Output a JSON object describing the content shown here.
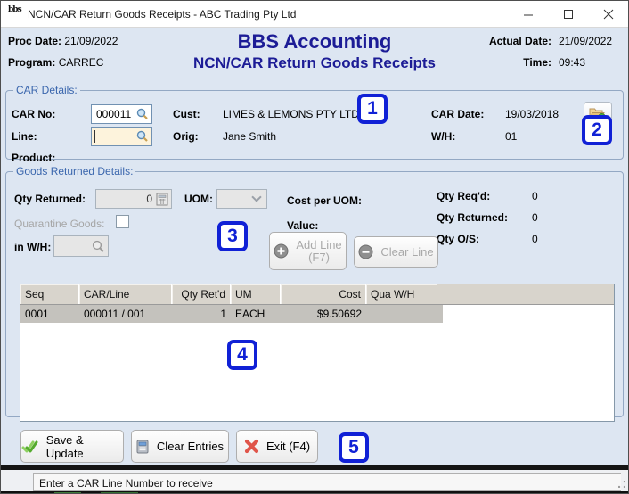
{
  "window": {
    "title": "NCN/CAR Return Goods Receipts - ABC Trading Pty Ltd",
    "icon_text": "bbs"
  },
  "header": {
    "proc_date_label": "Proc Date:",
    "proc_date": "21/09/2022",
    "program_label": "Program:",
    "program": "CARREC",
    "app_title": "BBS Accounting",
    "screen_title": "NCN/CAR Return Goods Receipts",
    "actual_date_label": "Actual Date:",
    "actual_date": "21/09/2022",
    "time_label": "Time:",
    "time": "09:43"
  },
  "car_details": {
    "legend": "CAR Details:",
    "car_no_label": "CAR No:",
    "car_no": "000011",
    "cust_label": "Cust:",
    "cust": "LIMES & LEMONS PTY LTD",
    "car_date_label": "CAR Date:",
    "car_date": "19/03/2018",
    "line_label": "Line:",
    "line": "",
    "orig_label": "Orig:",
    "orig": "Jane Smith",
    "wh_label": "W/H:",
    "wh": "01",
    "product_label": "Product:"
  },
  "goods": {
    "legend": "Goods Returned Details:",
    "qty_returned_label": "Qty Returned:",
    "qty_returned": "0",
    "uom_label": "UOM:",
    "cost_per_uom_label": "Cost per UOM:",
    "value_label": "Value:",
    "quarantine_label": "Quarantine Goods:",
    "in_wh_label": "in W/H:",
    "qty_reqd_label": "Qty Req'd:",
    "qty_reqd": "0",
    "qty_returned2_label": "Qty Returned:",
    "qty_returned2": "0",
    "qty_os_label": "Qty O/S:",
    "qty_os": "0",
    "add_line_label": "Add Line",
    "add_line_key": "(F7)",
    "clear_line_label": "Clear Line"
  },
  "table": {
    "columns": [
      "Seq",
      "CAR/Line",
      "Qty Ret'd",
      "UM",
      "Cost",
      "Qua W/H"
    ],
    "rows": [
      [
        "0001",
        "000011 / 001",
        "1",
        "EACH",
        "$9.50692",
        ""
      ]
    ]
  },
  "footer": {
    "save_label": "Save & Update",
    "clear_label": "Clear Entries",
    "exit_label": "Exit (F4)"
  },
  "status": {
    "message": "Enter a CAR Line Number to receive"
  },
  "annotations": [
    "1",
    "2",
    "3",
    "4",
    "5"
  ],
  "colors": {
    "accent_navy": "#1c1c96",
    "group_title_blue": "#3a66ad",
    "annotation_blue": "#1021d6",
    "selected_row_gray": "#c4c2bd",
    "cream_input": "#fdf3dc"
  }
}
